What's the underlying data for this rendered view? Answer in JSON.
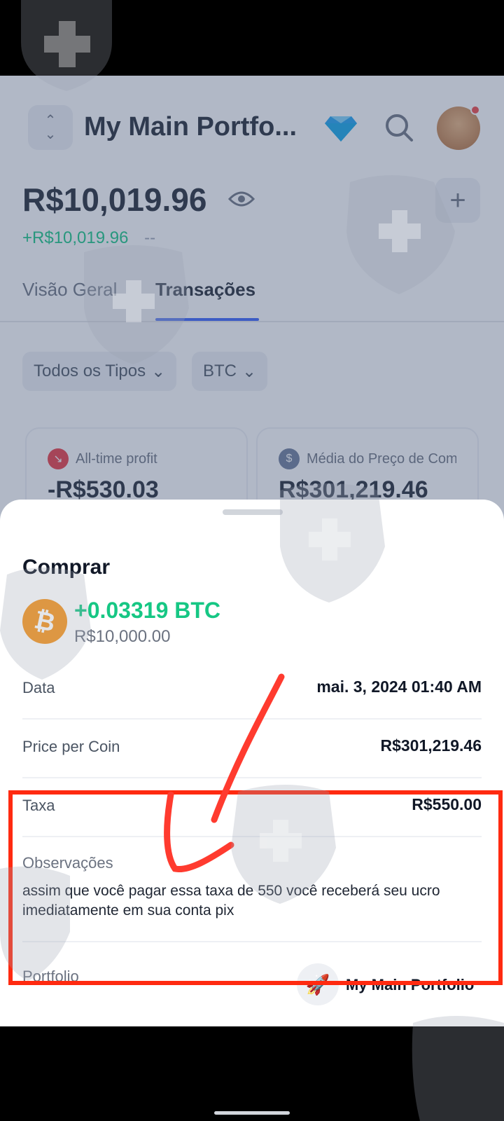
{
  "header": {
    "portfolio_title": "My Main Portfo...",
    "balance": "R$10,019.96",
    "change": "+R$10,019.96",
    "change_percent": "--",
    "add_label": "+"
  },
  "tabs": [
    {
      "label": "Visão Geral",
      "active": false
    },
    {
      "label": "Transações",
      "active": true
    }
  ],
  "filters": {
    "type": "Todos os Tipos",
    "coin": "BTC"
  },
  "stats": {
    "profit_label": "All-time profit",
    "profit_value": "-R$530.03",
    "avg_label": "Média do Preço de Com",
    "avg_value": "R$301,219.46"
  },
  "sheet": {
    "title": "Comprar",
    "amount": "+0.03319 BTC",
    "fiat": "R$10,000.00",
    "rows": [
      {
        "label": "Data",
        "value": "mai. 3, 2024 01:40 AM"
      },
      {
        "label": "Price per Coin",
        "value": "R$301,219.46"
      },
      {
        "label": "Taxa",
        "value": "R$550.00"
      }
    ],
    "notes_label": "Observações",
    "notes_text": "assim que você pagar essa taxa de 550 você receberá seu ucro imediatamente em sua conta pix",
    "portfolio_label": "Portfolio",
    "portfolio_name": "My Main Portfolio"
  },
  "icons": {
    "switch": "switch-portfolio-icon",
    "premium": "diamond-icon",
    "search": "search-icon",
    "visibility": "eye-icon",
    "coin": "bitcoin-icon",
    "portfolio": "rocket-icon"
  },
  "colors": {
    "positive": "#16c784",
    "negative": "#ea3943",
    "accent": "#3861fb",
    "annotation": "#ff2a10"
  }
}
